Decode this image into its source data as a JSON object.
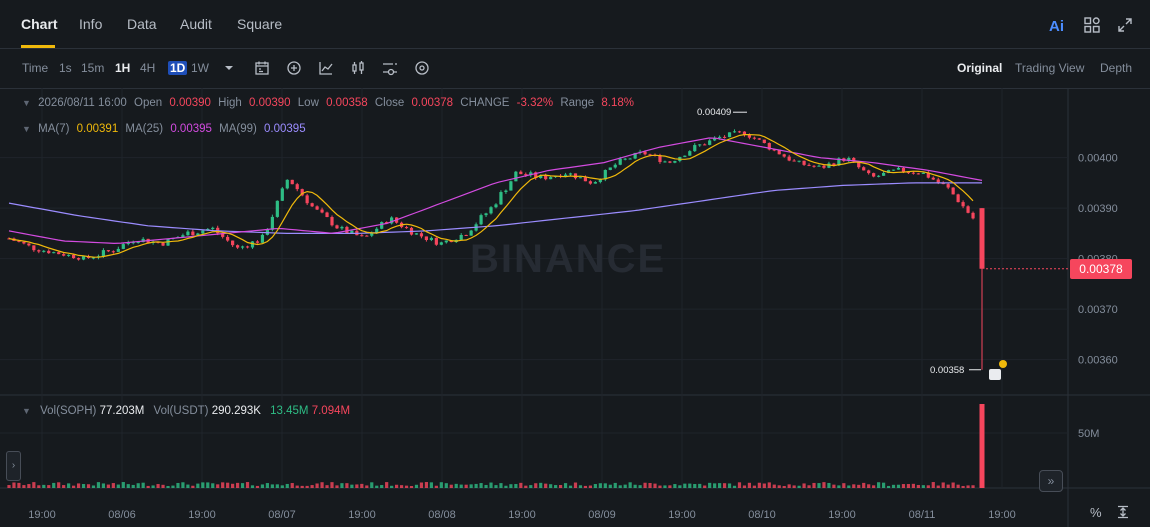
{
  "tabs": [
    {
      "label": "Chart",
      "active": true
    },
    {
      "label": "Info",
      "active": false
    },
    {
      "label": "Data",
      "active": false
    },
    {
      "label": "Audit",
      "active": false
    },
    {
      "label": "Square",
      "active": false
    }
  ],
  "header_icons": {
    "ai_label": "Ai",
    "grid": "grid-icon",
    "expand": "expand-icon"
  },
  "toolbar": {
    "intervals": [
      "Time",
      "1s",
      "15m",
      "1H",
      "4H",
      "1D",
      "1W"
    ],
    "active_interval": "1H",
    "boxed_interval": "1D",
    "dropdown": "chevron-down-icon",
    "tools": [
      "calendar-icon",
      "plus-circle-icon",
      "line-chart-icon",
      "candles-icon",
      "settings-slider-icon",
      "target-icon"
    ],
    "views": [
      {
        "label": "Original",
        "active": true
      },
      {
        "label": "Trading View",
        "active": false
      },
      {
        "label": "Depth",
        "active": false
      }
    ]
  },
  "ohlc": {
    "date": "2026/08/11 16:00",
    "open_label": "Open",
    "open": "0.00390",
    "high_label": "High",
    "high": "0.00390",
    "low_label": "Low",
    "low": "0.00358",
    "close_label": "Close",
    "close": "0.00378",
    "change_label": "CHANGE",
    "change": "-3.32%",
    "range_label": "Range",
    "range": "8.18%"
  },
  "ma": {
    "ma7_label": "MA(7)",
    "ma7": "0.00391",
    "ma25_label": "MA(25)",
    "ma25": "0.00395",
    "ma99_label": "MA(99)",
    "ma99": "0.00395"
  },
  "volume": {
    "soph_label": "Vol(SOPH)",
    "soph": "77.203M",
    "usdt_label": "Vol(USDT)",
    "usdt": "290.293K",
    "v1": "13.45M",
    "v2": "7.094M",
    "axis_label": "50M"
  },
  "price_axis": [
    "0.00400",
    "0.00390",
    "0.00380",
    "0.00370",
    "0.00360"
  ],
  "time_axis": [
    "19:00",
    "08/06",
    "19:00",
    "08/07",
    "19:00",
    "08/08",
    "19:00",
    "08/09",
    "19:00",
    "08/10",
    "19:00",
    "08/11",
    "19:00"
  ],
  "current_price": "0.00378",
  "high_marker": "0.00409",
  "low_marker": "0.00358",
  "watermark": "BINANCE",
  "bottom_icons": {
    "percent": "%",
    "auto_scale": "auto-scale-icon"
  },
  "colors": {
    "up": "#2ebd85",
    "down": "#f6465d",
    "ma7": "#f0b90b",
    "ma25": "#d34be0",
    "ma99": "#9b8cff",
    "accent": "#f0b90b"
  },
  "chart_data": {
    "type": "candlestick",
    "ylim": [
      0.00353,
      0.00413
    ],
    "y_ticks": [
      0.004,
      0.0039,
      0.0038,
      0.0037,
      0.0036
    ],
    "candle_anchors": [
      [
        0.00384,
        8e-06
      ],
      [
        0.00382,
        7e-06
      ],
      [
        0.00381,
        6e-06
      ],
      [
        0.0038,
        6e-06
      ],
      [
        0.003815,
        1e-05
      ],
      [
        0.00384,
        8e-06
      ],
      [
        0.00383,
        8e-06
      ],
      [
        0.00385,
        9e-06
      ],
      [
        0.00386,
        9e-06
      ],
      [
        0.00382,
        7e-06
      ],
      [
        0.00384,
        1e-05
      ],
      [
        0.00396,
        1e-05
      ],
      [
        0.0039,
        8e-06
      ],
      [
        0.00386,
        8e-06
      ],
      [
        0.00384,
        7e-06
      ],
      [
        0.00388,
        8e-06
      ],
      [
        0.00385,
        8e-06
      ],
      [
        0.00383,
        7e-06
      ],
      [
        0.00385,
        8e-06
      ],
      [
        0.0039,
        1e-05
      ],
      [
        0.00397,
        1e-05
      ],
      [
        0.00396,
        8e-06
      ],
      [
        0.00397,
        7e-06
      ],
      [
        0.00395,
        7e-06
      ],
      [
        0.00399,
        8e-06
      ],
      [
        0.00401,
        8e-06
      ],
      [
        0.00399,
        7e-06
      ],
      [
        0.00402,
        8e-06
      ],
      [
        0.00404,
        8e-06
      ],
      [
        0.00405,
        8e-06
      ],
      [
        0.00402,
        8e-06
      ],
      [
        0.00399,
        7e-06
      ],
      [
        0.00398,
        7e-06
      ],
      [
        0.004,
        8e-06
      ],
      [
        0.00396,
        7e-06
      ],
      [
        0.003975,
        7e-06
      ],
      [
        0.00397,
        7e-06
      ],
      [
        0.00394,
        7e-06
      ],
      [
        0.00388,
        8e-06
      ]
    ],
    "last_candle": {
      "open": 0.0039,
      "high": 0.0039,
      "low": 0.00358,
      "close": 0.00378
    },
    "ma99_anchors": [
      0.00391,
      0.003885,
      0.003865,
      0.003855,
      0.00385,
      0.00385,
      0.003855,
      0.003865,
      0.00388,
      0.003895,
      0.003915,
      0.003935,
      0.003945,
      0.00395,
      0.00395
    ],
    "ma25_anchors": [
      0.003855,
      0.003835,
      0.00383,
      0.00384,
      0.00385,
      0.00386,
      0.00385,
      0.00387,
      0.00391,
      0.00395,
      0.003975,
      0.00399,
      0.00402,
      0.00404,
      0.00402,
      0.004,
      0.00399,
      0.003975,
      0.003955
    ],
    "volume_spike": 77.203,
    "volume_unit": "M"
  }
}
